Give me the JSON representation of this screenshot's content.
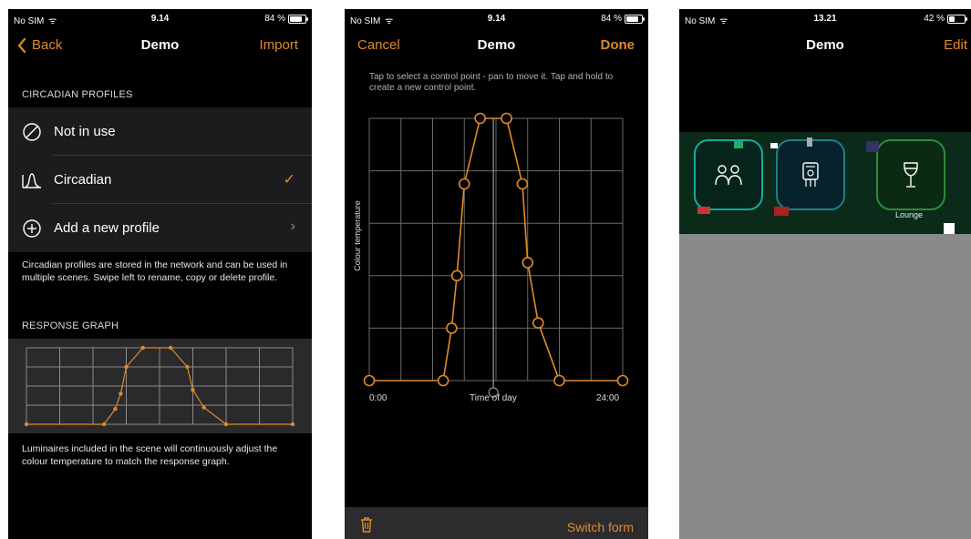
{
  "screens": [
    {
      "status": {
        "carrier": "No SIM",
        "time": "9.14",
        "battery": "84 %",
        "battery_level": 0.84
      },
      "nav": {
        "back": "Back",
        "title": "Demo",
        "action": "Import"
      },
      "section1": "CIRCADIAN PROFILES",
      "profiles": [
        {
          "label": "Not in use",
          "icon": "not-in-use-icon",
          "accessory": ""
        },
        {
          "label": "Circadian",
          "icon": "circadian-curve-icon",
          "accessory": "✓"
        },
        {
          "label": "Add a new profile",
          "icon": "plus-circle-icon",
          "accessory": "›"
        }
      ],
      "profiles_note": "Circadian profiles are stored in the network and can be used in multiple scenes. Swipe left to rename, copy or delete profile.",
      "section2": "RESPONSE GRAPH",
      "graph_note": "Luminaires included in the scene will continuously adjust the colour temperature to match the response graph."
    },
    {
      "status": {
        "carrier": "No SIM",
        "time": "9.14",
        "battery": "84 %",
        "battery_level": 0.84
      },
      "nav": {
        "cancel": "Cancel",
        "title": "Demo",
        "done": "Done"
      },
      "hint": "Tap to select a control point - pan to move it. Tap and hold to create a new control point.",
      "y_axis_label": "Colour temperature",
      "x_start": "0:00",
      "x_center": "Time of day",
      "x_end": "24:00",
      "toolbar": {
        "delete_icon": "trash-icon",
        "switch": "Switch form"
      }
    },
    {
      "status": {
        "carrier": "No SIM",
        "time": "13.21",
        "battery": "42 %",
        "battery_level": 0.42
      },
      "nav": {
        "title": "Demo",
        "edit": "Edit"
      },
      "scenes": [
        {
          "icon": "people-icon",
          "label": "",
          "color": "#1aa89a"
        },
        {
          "icon": "device-icon",
          "label": "",
          "color": "#1f7f8a"
        },
        {
          "icon": "wine-glass-icon",
          "label": "Lounge",
          "color": "#2e8b3a"
        }
      ]
    }
  ],
  "colors": {
    "accent": "#e08a2a",
    "background": "#000000",
    "cell": "#1c1c1e",
    "graph_line": "#e08a2a"
  },
  "curve_points": [
    [
      0,
      0
    ],
    [
      7,
      0
    ],
    [
      8,
      20
    ],
    [
      8.5,
      40
    ],
    [
      9,
      75
    ],
    [
      10.5,
      100
    ],
    [
      13,
      100
    ],
    [
      14.5,
      75
    ],
    [
      15,
      45
    ],
    [
      16,
      22
    ],
    [
      18,
      0
    ],
    [
      24,
      0
    ]
  ],
  "curve_points_editor": [
    [
      0,
      0
    ],
    [
      7,
      0
    ],
    [
      7.8,
      20
    ],
    [
      8.3,
      40
    ],
    [
      9,
      75
    ],
    [
      10.5,
      100
    ],
    [
      13,
      100
    ],
    [
      14.5,
      75
    ],
    [
      15,
      45
    ],
    [
      16,
      22
    ],
    [
      18,
      0
    ],
    [
      24,
      0
    ]
  ]
}
